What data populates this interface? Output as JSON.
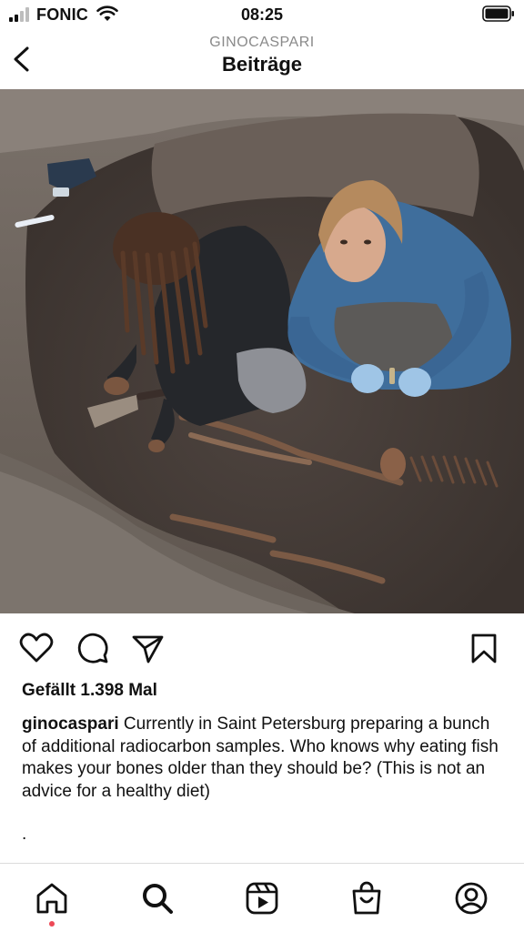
{
  "status_bar": {
    "carrier": "FONIC",
    "time": "08:25",
    "icons": [
      "signal-icon",
      "wifi-icon",
      "battery-icon"
    ]
  },
  "header": {
    "username": "GINOCASPARI",
    "title": "Beiträge",
    "back_icon": "chevron-left-icon"
  },
  "post": {
    "photo_description": "two-researchers-excavating-skeleton",
    "actions": [
      "heart-icon",
      "comment-icon",
      "share-icon",
      "bookmark-icon"
    ],
    "likes_text": "Gefällt 1.398 Mal",
    "caption_username": "ginocaspari",
    "caption_text": " Currently in Saint Petersburg preparing a bunch of additional radiocarbon samples. Who knows why eating fish makes your bones older than they should be? (This is not an advice for a healthy diet)",
    "caption_more": "."
  },
  "bottom_nav": {
    "items": [
      "home-icon",
      "search-icon",
      "reels-icon",
      "shop-icon",
      "profile-icon"
    ],
    "notification_color": "#ed4956"
  }
}
